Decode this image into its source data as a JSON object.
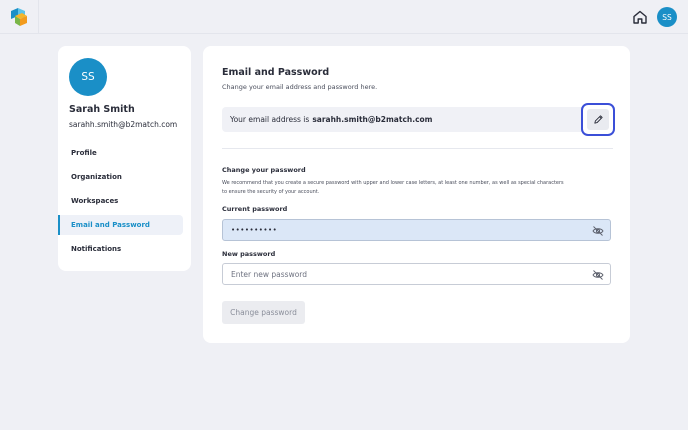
{
  "header": {
    "logo_icon": "b2match-logo-icon",
    "home_icon": "home-icon",
    "avatar_initials": "SS"
  },
  "profile": {
    "initials": "SS",
    "name": "Sarah Smith",
    "email": "sarahh.smith@b2match.com"
  },
  "nav": {
    "items": [
      {
        "label": "Profile",
        "active": false
      },
      {
        "label": "Organization",
        "active": false
      },
      {
        "label": "Workspaces",
        "active": false
      },
      {
        "label": "Email and Password",
        "active": true
      },
      {
        "label": "Notifications",
        "active": false
      }
    ]
  },
  "main": {
    "title": "Email and Password",
    "subtitle": "Change your email address and password here.",
    "email_prefix": "Your email address is",
    "email_value": "sarahh.smith@b2match.com",
    "edit_icon": "pencil-icon",
    "change_password": {
      "title": "Change your password",
      "description": "We recommend that you create a secure password with upper and lower case letters, at least one number, as well as special characters to ensure the security of your account.",
      "current_label": "Current password",
      "current_value": "••••••••••",
      "new_label": "New password",
      "new_placeholder": "Enter new password",
      "button_label": "Change password"
    }
  },
  "colors": {
    "accent": "#1a8fc7",
    "highlight_border": "#3b4fd8",
    "background": "#eff0f5"
  }
}
